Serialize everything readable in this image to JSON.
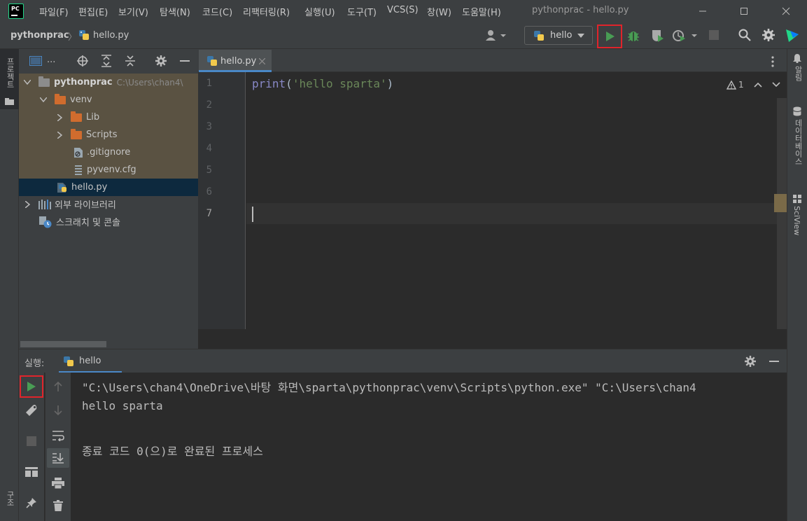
{
  "app": {
    "logo_text": "PC",
    "window_title": "pythonprac - hello.py"
  },
  "menu": [
    "파일(F)",
    "편집(E)",
    "보기(V)",
    "탐색(N)",
    "코드(C)",
    "리팩터링(R)",
    "실행(U)",
    "도구(T)",
    "VCS(S)",
    "창(W)",
    "도움말(H)"
  ],
  "breadcrumb": {
    "project": "pythonprac",
    "separator": "〉",
    "file": "hello.py"
  },
  "run_config": {
    "name": "hello",
    "icon": "python-icon"
  },
  "project_panel": {
    "header_icon": "project-view-icon",
    "header_label": "...",
    "tree": [
      {
        "label": "pythonprac",
        "path": "C:\\Users\\chan4\\",
        "type": "folder-grey",
        "expanded": true
      },
      {
        "label": "venv",
        "type": "folder-orange",
        "expanded": true
      },
      {
        "label": "Lib",
        "type": "folder-orange",
        "expanded": false
      },
      {
        "label": "Scripts",
        "type": "folder-orange",
        "expanded": false
      },
      {
        "label": ".gitignore",
        "type": "file"
      },
      {
        "label": "pyvenv.cfg",
        "type": "file"
      },
      {
        "label": "hello.py",
        "type": "python-file"
      },
      {
        "label": "외부 라이브러리",
        "type": "library"
      },
      {
        "label": "스크래치 및 콘솔",
        "type": "scratch"
      }
    ]
  },
  "left_strip": {
    "project_label": "프로젝트",
    "structure_label": "구조"
  },
  "right_strip": {
    "notifications_label": "알림",
    "database_label": "데이터베이스",
    "sciview_label": "SciView"
  },
  "editor": {
    "tab_label": "hello.py",
    "line_numbers": [
      "1",
      "2",
      "3",
      "4",
      "5",
      "6",
      "7"
    ],
    "code": {
      "func": "print",
      "open": "(",
      "string": "'hello sparta'",
      "close": ")"
    },
    "warning_count": "1"
  },
  "run_panel": {
    "title": "실행:",
    "tab_label": "hello",
    "console_lines": [
      "\"C:\\Users\\chan4\\OneDrive\\바탕 화면\\sparta\\pythonprac\\venv\\Scripts\\python.exe\" \"C:\\Users\\chan4",
      "hello sparta",
      "",
      "종료 코드 0(으)로 완료된 프로세스"
    ]
  },
  "colors": {
    "accent_run": "#499c54",
    "highlight_box": "#e0242b",
    "keyword_purple": "#8888c6",
    "string_green": "#6a8759"
  }
}
